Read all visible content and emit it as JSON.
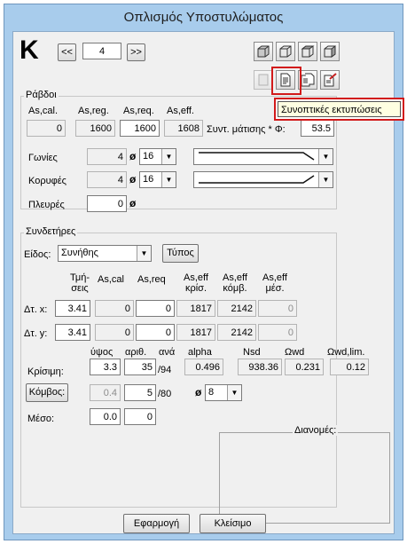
{
  "window": {
    "title": "Οπλισμός Υποστυλώματος"
  },
  "header": {
    "big_letter": "K",
    "prev_label": "<<",
    "next_label": ">>",
    "number_value": "4"
  },
  "tooltip": {
    "text": "Συνοπτικές εκτυπώσεις"
  },
  "bars": {
    "group_title": "Ράβδοι",
    "col_headers": [
      "As,cal.",
      "As,reg.",
      "As,req.",
      "As,eff."
    ],
    "values": [
      "0",
      "1600",
      "1600",
      "1608"
    ],
    "ratio_label": "Συντ. μάτισης * Φ:",
    "ratio_value": "53.5",
    "corners": {
      "label": "Γωνίες",
      "count": "4",
      "diameter": "16"
    },
    "tops": {
      "label": "Κορυφές",
      "count": "4",
      "diameter": "16"
    },
    "sides": {
      "label": "Πλευρές",
      "count": "0"
    },
    "phi_symbol": "ø"
  },
  "stirrups": {
    "group_title": "Συνδετήρες",
    "type_label": "Είδος:",
    "type_value": "Συνήθης",
    "types_button": "Τύπος",
    "col_headers": {
      "section_1": "Τμή-",
      "section_2": "σεις",
      "as_cal": "As,cal",
      "as_req": "As,req",
      "as_eff_crit_1": "As,eff",
      "as_eff_crit_2": "κρίσ.",
      "as_eff_node_1": "As,eff",
      "as_eff_node_2": "κόμβ.",
      "as_eff_mid_1": "As,eff",
      "as_eff_mid_2": "μέσ."
    },
    "rows": [
      {
        "label": "Δτ. x:",
        "section": "3.41",
        "as_cal": "0",
        "as_req": "0",
        "as_eff_crit": "1817",
        "as_eff_node": "2142",
        "as_eff_mid": "0"
      },
      {
        "label": "Δτ. y:",
        "section": "3.41",
        "as_cal": "0",
        "as_req": "0",
        "as_eff_crit": "1817",
        "as_eff_node": "2142",
        "as_eff_mid": "0"
      }
    ],
    "zone_headers": {
      "height": "ύψος",
      "count": "αριθ.",
      "per": "ανά",
      "alpha": "alpha",
      "nsd": "Nsd",
      "wd": "Ωwd",
      "wd_lim": "Ωwd,lim."
    },
    "critical": {
      "label": "Κρίσιμη:",
      "height": "3.3",
      "count": "35",
      "spacing": "/94",
      "alpha": "0.496",
      "nsd": "938.36",
      "wd": "0.231",
      "wd_lim": "0.12"
    },
    "node": {
      "label": "Κόμβος:",
      "height": "0.4",
      "count": "5",
      "spacing": "/80",
      "diameter": "8"
    },
    "middle": {
      "label": "Μέσο:",
      "height": "0.0",
      "count": "0"
    },
    "distributions_title": "Διανομές:"
  },
  "footer": {
    "apply_button": "Εφαρμογή",
    "close_button": "Κλείσιμο"
  },
  "colors": {
    "window_frame": "#a8ccec",
    "highlight_red": "#d21a1a"
  }
}
